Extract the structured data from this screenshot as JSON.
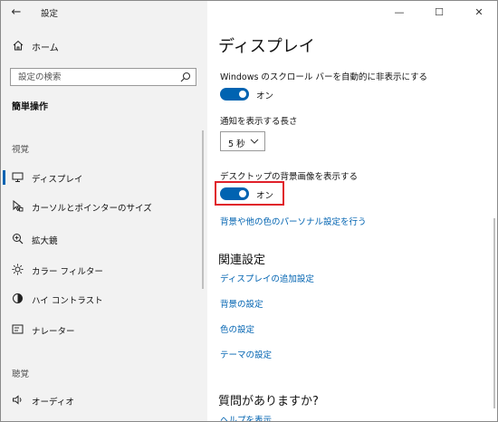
{
  "window": {
    "title": "設定",
    "back_glyph": "←",
    "minimize_glyph": "—",
    "maximize_glyph": "☐",
    "close_glyph": "✕"
  },
  "sidebar": {
    "home_label": "ホーム",
    "search_placeholder": "設定の検索",
    "section_heading": "簡単操作",
    "groups": {
      "vision": "視覚",
      "hearing": "聴覚"
    },
    "items": [
      {
        "label": "ディスプレイ",
        "icon": "monitor-icon",
        "selected": true
      },
      {
        "label": "カーソルとポインターのサイズ",
        "icon": "cursor-icon",
        "selected": false
      },
      {
        "label": "拡大鏡",
        "icon": "magnifier-icon",
        "selected": false
      },
      {
        "label": "カラー フィルター",
        "icon": "color-filter-icon",
        "selected": false
      },
      {
        "label": "ハイ コントラスト",
        "icon": "high-contrast-icon",
        "selected": false
      },
      {
        "label": "ナレーター",
        "icon": "narrator-icon",
        "selected": false
      },
      {
        "label": "オーディオ",
        "icon": "speaker-icon",
        "selected": false
      }
    ]
  },
  "main": {
    "page_title": "ディスプレイ",
    "scrollbar_setting": {
      "label": "Windows のスクロール バーを自動的に非表示にする",
      "state": "オン"
    },
    "notification_setting": {
      "label": "通知を表示する長さ",
      "value": "5 秒"
    },
    "background_setting": {
      "label": "デスクトップの背景画像を表示する",
      "state": "オン"
    },
    "personalize_link": "背景や他の色のパーソナル設定を行う",
    "related": {
      "heading": "関連設定",
      "links": [
        "ディスプレイの追加設定",
        "背景の設定",
        "色の設定",
        "テーマの設定"
      ]
    },
    "questions": {
      "heading": "質問がありますか?",
      "link": "ヘルプを表示"
    }
  },
  "colors": {
    "accent": "#0063b1",
    "highlight": "#e0202a",
    "sidebar_bg": "#f2f2f2"
  }
}
